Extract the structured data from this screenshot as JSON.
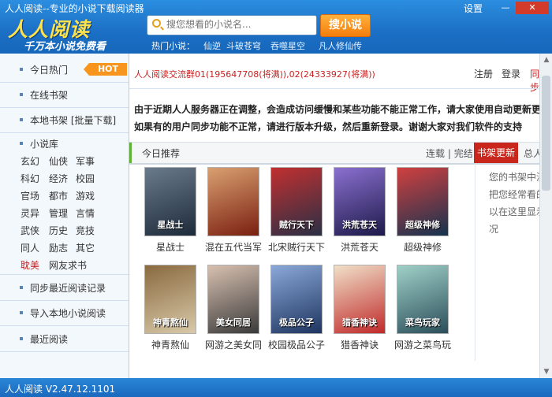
{
  "window": {
    "title": "人人阅读--专业的小说下载阅读器",
    "settings_label": "设置",
    "minimize_glyph": "—",
    "close_glyph": "✕"
  },
  "brand": {
    "logo": "人人阅读",
    "slogan": "千万本小说免费看"
  },
  "search": {
    "placeholder": "搜您想看的小说名...",
    "button_label": "搜小说"
  },
  "hot_novels": {
    "label": "热门小说：",
    "items": [
      "仙逆",
      "斗破苍穹",
      "吞噬星空",
      "凡人修仙传"
    ]
  },
  "sidebar": {
    "items": [
      {
        "label": "今日热门",
        "badge": "HOT"
      },
      {
        "label": "在线书架"
      },
      {
        "label": "本地书架 [批量下载]"
      }
    ],
    "library_label": "小说库",
    "categories": [
      "玄幻",
      "仙侠",
      "军事",
      "科幻",
      "经济",
      "校园",
      "官场",
      "都市",
      "游戏",
      "灵异",
      "管理",
      "言情",
      "武侠",
      "历史",
      "竞技",
      "同人",
      "励志",
      "其它",
      "耽美",
      "网友求书"
    ],
    "bottom_items": [
      "同步最近阅读记录",
      "导入本地小说阅读",
      "最近阅读"
    ]
  },
  "topbar": {
    "group_notice": "人人阅读交流群01(195647708(将满)),02(24333927(将满))",
    "register": "注册",
    "login": "登录",
    "sync": "同步"
  },
  "announcement": {
    "line1": "由于近期人人服务器正在调整，会造成访问缓慢和某些功能不能正常工作，请大家使用自动更新更新到最",
    "line2": "如果有的用户同步功能不正常，请进行版本升级，然后重新登录。谢谢大家对我们软件的支持"
  },
  "recommend": {
    "title": "今日推荐",
    "tab_serial": "连载",
    "tab_sep": "|",
    "tab_finished": "完结",
    "tab_shelf": "书架更新",
    "tab_total": "总人",
    "books": [
      {
        "title": "星战士",
        "cover_text": "星战士",
        "c1": "#1d2a3a",
        "c2": "#6a7b8c"
      },
      {
        "title": "混在五代当军",
        "cover_text": "",
        "c1": "#7a1f10",
        "c2": "#d9a070"
      },
      {
        "title": "北宋贼行天下",
        "cover_text": "贼行天下",
        "c1": "#2a2f45",
        "c2": "#c03030"
      },
      {
        "title": "洪荒苍天",
        "cover_text": "洪荒苍天",
        "c1": "#1e1a4a",
        "c2": "#8a70d0"
      },
      {
        "title": "超级神修",
        "cover_text": "超级神修",
        "c1": "#15334f",
        "c2": "#d04040"
      },
      {
        "title": "神青熬仙",
        "cover_text": "神青熬仙",
        "c1": "#d8c9a8",
        "c2": "#8a6a40"
      },
      {
        "title": "网游之美女同",
        "cover_text": "美女同居",
        "c1": "#3a3a3a",
        "c2": "#d8c0b0"
      },
      {
        "title": "校园极品公子",
        "cover_text": "极品公子",
        "c1": "#1e3560",
        "c2": "#8aa8d8"
      },
      {
        "title": "猎香神诀",
        "cover_text": "猎香神诀",
        "c1": "#c02a2a",
        "c2": "#f0e0c8"
      },
      {
        "title": "网游之菜鸟玩",
        "cover_text": "菜鸟玩家",
        "c1": "#2a4e5a",
        "c2": "#a0d0c8"
      }
    ],
    "shelf_note": [
      "您的书架中没",
      "把您经常看的",
      "以在这里显示",
      "况"
    ]
  },
  "status": {
    "version": "人人阅读 V2.47.12.1101"
  }
}
